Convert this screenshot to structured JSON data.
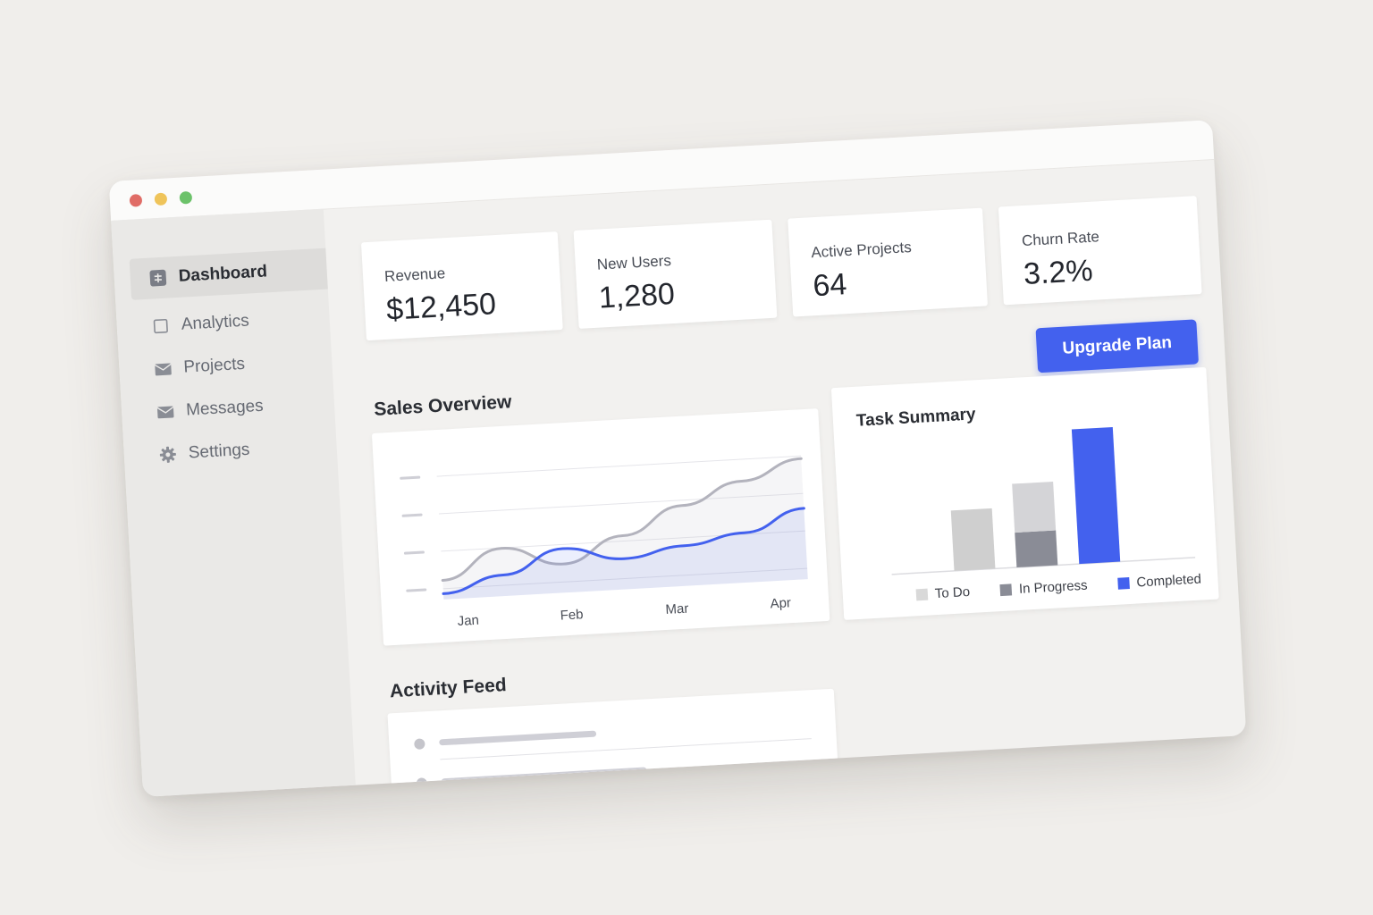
{
  "window": {
    "controls": [
      "close",
      "minimize",
      "maximize"
    ]
  },
  "sidebar": {
    "items": [
      {
        "label": "Dashboard",
        "icon": "dashboard-icon",
        "active": true
      },
      {
        "label": "Analytics",
        "icon": "analytics-icon",
        "active": false
      },
      {
        "label": "Projects",
        "icon": "folder-icon",
        "active": false
      },
      {
        "label": "Messages",
        "icon": "mail-icon",
        "active": false
      },
      {
        "label": "Settings",
        "icon": "gear-icon",
        "active": false
      }
    ]
  },
  "stats": [
    {
      "label": "Revenue",
      "value": "$12,450"
    },
    {
      "label": "New Users",
      "value": "1,280"
    },
    {
      "label": "Active Projects",
      "value": "64"
    },
    {
      "label": "Churn Rate",
      "value": "3.2%"
    }
  ],
  "upgrade_button": {
    "label": "Upgrade Plan"
  },
  "sales": {
    "title": "Sales Overview"
  },
  "tasks": {
    "title": "Task Summary"
  },
  "activity": {
    "title": "Activity Feed"
  },
  "colors": {
    "accent": "#4361ee",
    "gray_line": "#b3b3bd",
    "todo": "#cfcfcf",
    "in_progress": "#8a8c96"
  },
  "chart_data": [
    {
      "type": "line",
      "title": "Sales Overview",
      "x": [
        "Jan",
        "Feb",
        "Mar",
        "Apr"
      ],
      "series": [
        {
          "values": [
            1.0,
            2.5,
            1.5,
            2.8,
            4.2,
            5.3,
            6.3
          ]
        },
        {
          "values": [
            0.3,
            1.1,
            2.3,
            1.6,
            2.1,
            2.6,
            3.7
          ]
        }
      ],
      "ylim": [
        0,
        7
      ],
      "grid": true
    },
    {
      "type": "bar",
      "title": "Task Summary",
      "categories": [
        "To Do",
        "In Progress",
        "Completed"
      ],
      "series": [
        {
          "name": "To Do",
          "values": [
            26,
            0,
            0
          ]
        },
        {
          "name": "In Progress",
          "values": [
            0,
            15,
            0
          ]
        },
        {
          "name": "Completed",
          "values": [
            0,
            0,
            58
          ]
        },
        {
          "name": "To Do",
          "values": [
            0,
            21,
            0
          ]
        }
      ],
      "legend": "bottom"
    }
  ]
}
